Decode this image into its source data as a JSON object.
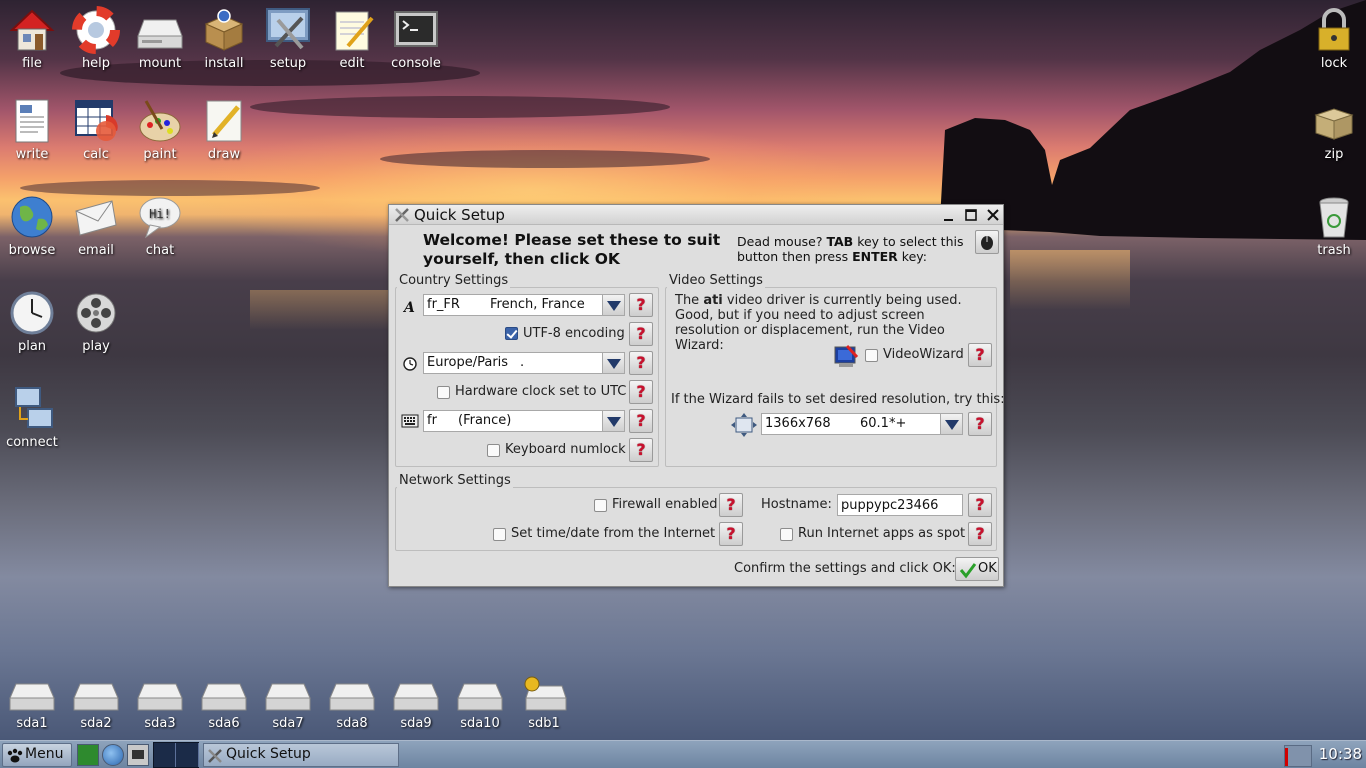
{
  "desktop": {
    "left_icons": [
      {
        "label": "file",
        "icon": "house-icon"
      },
      {
        "label": "help",
        "icon": "lifebuoy-icon"
      },
      {
        "label": "mount",
        "icon": "drive-icon"
      },
      {
        "label": "install",
        "icon": "box-icon"
      },
      {
        "label": "setup",
        "icon": "setup-tools-icon"
      },
      {
        "label": "edit",
        "icon": "notepad-icon"
      },
      {
        "label": "console",
        "icon": "terminal-icon"
      },
      {
        "label": "write",
        "icon": "document-icon"
      },
      {
        "label": "calc",
        "icon": "spreadsheet-icon"
      },
      {
        "label": "paint",
        "icon": "palette-icon"
      },
      {
        "label": "draw",
        "icon": "pencil-icon"
      },
      {
        "label": "browse",
        "icon": "globe-icon"
      },
      {
        "label": "email",
        "icon": "envelope-icon"
      },
      {
        "label": "chat",
        "icon": "speech-bubble-icon"
      },
      {
        "label": "plan",
        "icon": "clock-icon"
      },
      {
        "label": "play",
        "icon": "film-reel-icon"
      },
      {
        "label": "connect",
        "icon": "network-icon"
      }
    ],
    "right_icons": [
      {
        "label": "lock",
        "icon": "padlock-icon"
      },
      {
        "label": "zip",
        "icon": "archive-box-icon"
      },
      {
        "label": "trash",
        "icon": "trash-icon"
      }
    ],
    "drives": [
      "sda1",
      "sda2",
      "sda3",
      "sda6",
      "sda7",
      "sda8",
      "sda9",
      "sda10",
      "sdb1"
    ],
    "chat_bubble_text": "Hi!"
  },
  "window": {
    "title": "Quick Setup",
    "welcome": "Welcome! Please set these to suit yourself, then click OK",
    "deadmouse": {
      "part1": "Dead mouse? ",
      "tab": "TAB",
      "part2": " key to select this button then press ",
      "enter": "ENTER",
      "part3": " key:"
    },
    "country": {
      "title": "Country Settings",
      "locale_code": "fr_FR",
      "locale_name": "French, France",
      "utf8_label": "UTF-8 encoding",
      "utf8_checked": true,
      "timezone": "Europe/Paris",
      "timezone_suffix": ".",
      "hwclock_label": "Hardware clock set to UTC",
      "hwclock_checked": false,
      "keyboard_code": "fr",
      "keyboard_name": "(France)",
      "numlock_label": "Keyboard numlock",
      "numlock_checked": false
    },
    "video": {
      "title": "Video Settings",
      "text_part1": "The ",
      "driver": "ati",
      "text_part2": " video driver is currently being used. Good, but if you need to adjust screen resolution or displacement, run the Video Wizard:",
      "videowizard_label": "VideoWizard",
      "videowizard_checked": false,
      "fail_text": "If the Wizard fails to set desired resolution, try this:",
      "resolution": "1366x768",
      "refresh": "60.1*+"
    },
    "network": {
      "title": "Network Settings",
      "firewall_label": "Firewall enabled",
      "firewall_checked": false,
      "hostname_label": "Hostname:",
      "hostname_value": "puppypc23466",
      "timedate_label": "Set time/date from the Internet",
      "timedate_checked": false,
      "spot_label": "Run Internet apps as spot",
      "spot_checked": false
    },
    "help_glyph": "?",
    "confirm_text": "Confirm the settings and click OK:",
    "ok_label": "OK"
  },
  "taskbar": {
    "menu_label": "Menu",
    "task_label": "Quick Setup",
    "clock": "10:38"
  },
  "colors": {
    "help_red": "#c8102e",
    "checkbox_blue": "#3b63a9",
    "combo_arrow": "#223a6a",
    "taskbar": "#7f95b1"
  }
}
